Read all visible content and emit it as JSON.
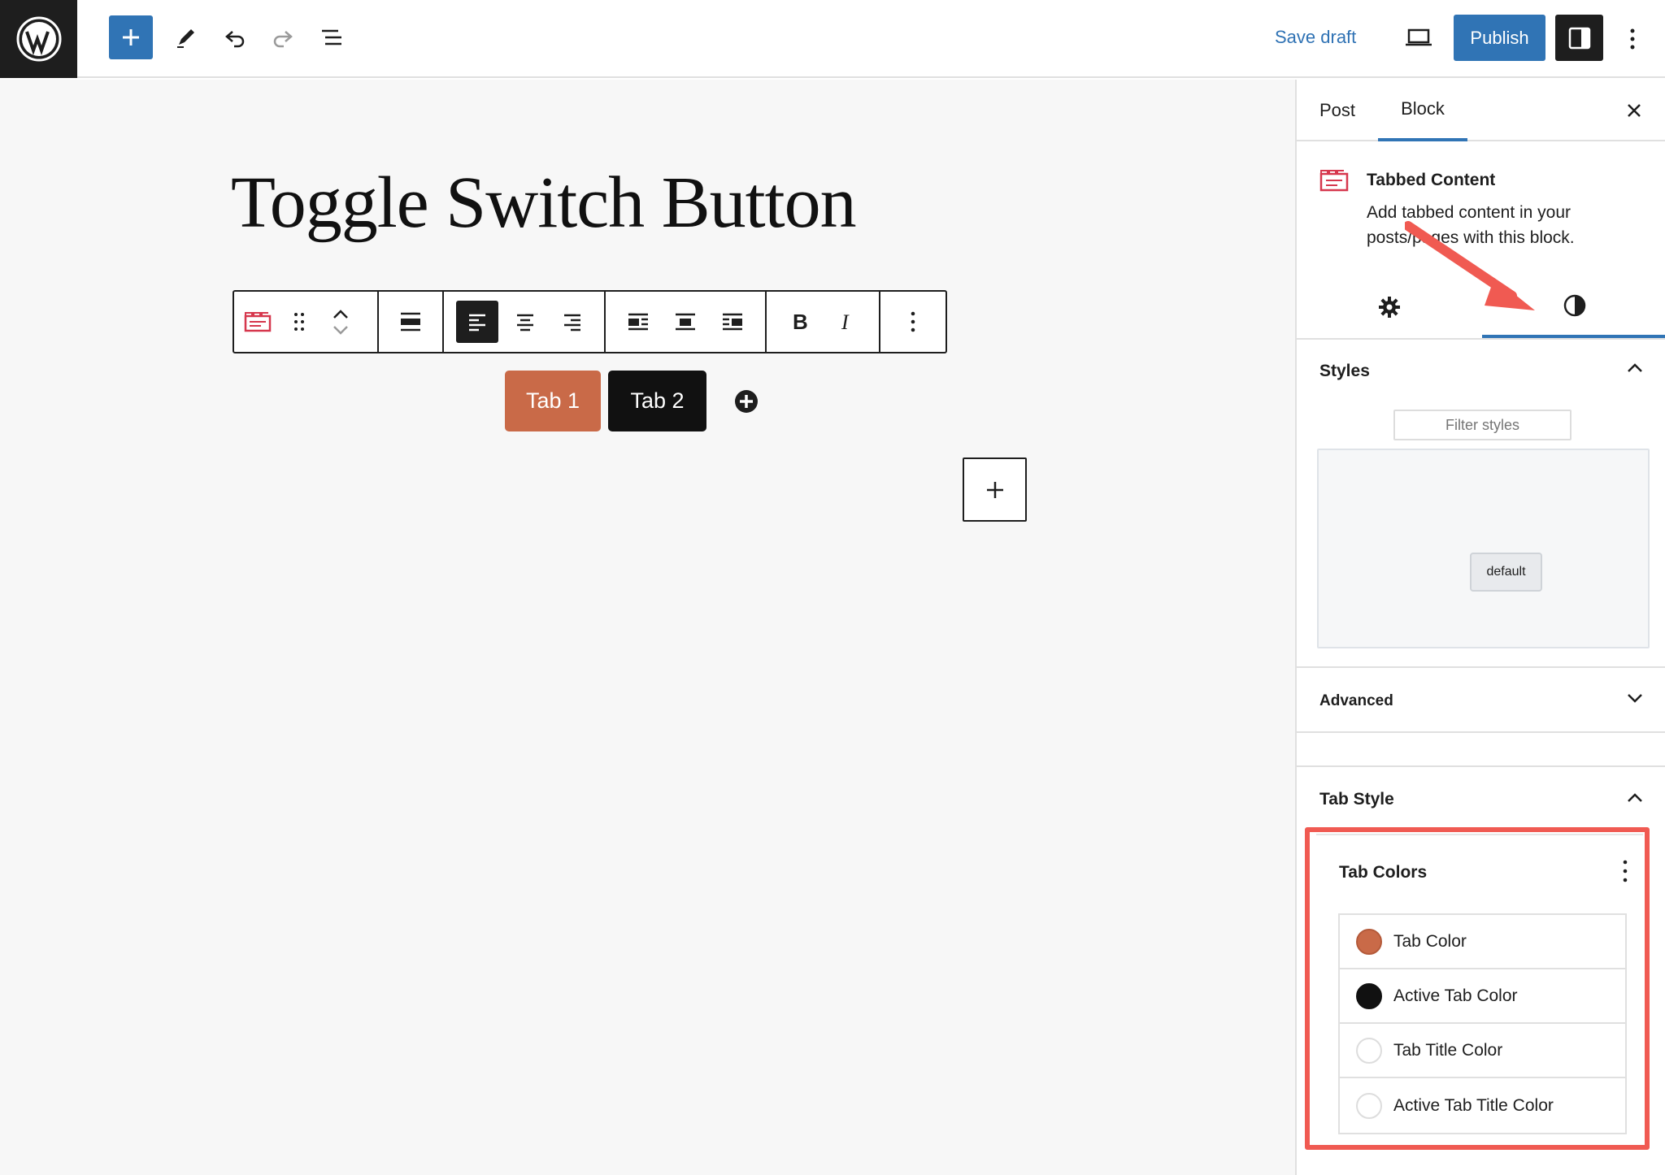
{
  "topbar": {
    "save_draft": "Save draft",
    "publish": "Publish"
  },
  "editor": {
    "post_title": "Toggle Switch Button",
    "tabs": [
      {
        "label": "Tab 1",
        "color": "#c96a48"
      },
      {
        "label": "Tab 2",
        "color": "#111111"
      }
    ]
  },
  "sidebar": {
    "tabs": {
      "post": "Post",
      "block": "Block"
    },
    "block_card": {
      "title": "Tabbed Content",
      "description": "Add tabbed content in your posts/pages with this block."
    },
    "styles": {
      "heading": "Styles",
      "filter_placeholder": "Filter styles",
      "style_chip": "default"
    },
    "advanced": {
      "heading": "Advanced"
    },
    "tab_style": {
      "heading": "Tab Style",
      "tab_colors": {
        "heading": "Tab Colors",
        "items": [
          {
            "label": "Tab Color",
            "swatch": "#c96a48"
          },
          {
            "label": "Active Tab Color",
            "swatch": "#111111"
          },
          {
            "label": "Tab Title Color",
            "swatch": "#ffffff"
          },
          {
            "label": "Active Tab Title Color",
            "swatch": "#ffffff"
          }
        ]
      }
    }
  },
  "colors": {
    "accent": "#3074b5",
    "highlight": "#f05a52"
  }
}
